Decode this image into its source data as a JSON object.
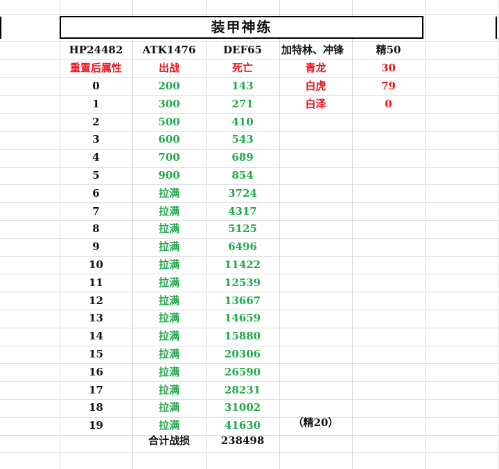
{
  "title": "装甲神练",
  "header_row": [
    "HP24482",
    "ATK1476",
    "DEF65",
    "加特林、冲锋",
    "精50"
  ],
  "label_row": [
    "重置后属性",
    "出战",
    "死亡",
    "青龙",
    "30"
  ],
  "side_values": [
    {
      "name": "白虎",
      "value": "79"
    },
    {
      "name": "白泽",
      "value": "0"
    }
  ],
  "rows": [
    {
      "level": "0",
      "sortie": "200",
      "death": "143"
    },
    {
      "level": "1",
      "sortie": "300",
      "death": "271"
    },
    {
      "level": "2",
      "sortie": "500",
      "death": "410"
    },
    {
      "level": "3",
      "sortie": "600",
      "death": "543"
    },
    {
      "level": "4",
      "sortie": "700",
      "death": "689"
    },
    {
      "level": "5",
      "sortie": "900",
      "death": "854"
    },
    {
      "level": "6",
      "sortie": "拉满",
      "death": "3724"
    },
    {
      "level": "7",
      "sortie": "拉满",
      "death": "4317"
    },
    {
      "level": "8",
      "sortie": "拉满",
      "death": "5125"
    },
    {
      "level": "9",
      "sortie": "拉满",
      "death": "6496"
    },
    {
      "level": "10",
      "sortie": "拉满",
      "death": "11422"
    },
    {
      "level": "11",
      "sortie": "拉满",
      "death": "12539"
    },
    {
      "level": "12",
      "sortie": "拉满",
      "death": "13667"
    },
    {
      "level": "13",
      "sortie": "拉满",
      "death": "14659"
    },
    {
      "level": "14",
      "sortie": "拉满",
      "death": "15880"
    },
    {
      "level": "15",
      "sortie": "拉满",
      "death": "20306"
    },
    {
      "level": "16",
      "sortie": "拉满",
      "death": "26590"
    },
    {
      "level": "17",
      "sortie": "拉满",
      "death": "28231"
    },
    {
      "level": "18",
      "sortie": "拉满",
      "death": "31002"
    },
    {
      "level": "19",
      "sortie": "拉满",
      "death": "41630"
    }
  ],
  "note_19": "（精20）",
  "total_label": "合计战损",
  "total_value": "238498",
  "colors": {
    "label": "#e8141b",
    "value": "#20a84a",
    "text": "#111111"
  }
}
